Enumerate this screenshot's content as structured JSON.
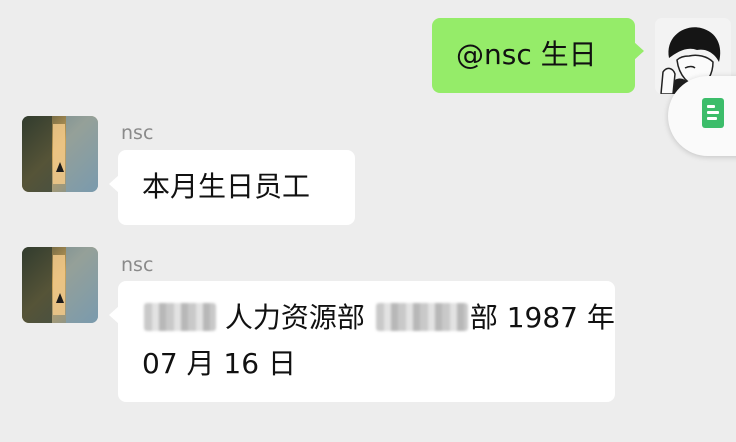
{
  "messages": [
    {
      "direction": "outgoing",
      "text": "@nsc  生日"
    },
    {
      "direction": "incoming",
      "sender": "nsc",
      "text": "本月生日员工"
    },
    {
      "direction": "incoming",
      "sender": "nsc",
      "text_part_1": "人力资源部",
      "text_part_2": "部 1987 年",
      "text_line_2": "07 月 16 日",
      "redacted": true
    }
  ],
  "icons": {
    "floating_button": "document-icon",
    "self_avatar": "user-avatar",
    "bot_avatar": "nsc-avatar"
  },
  "colors": {
    "background": "#ededed",
    "outgoing_bubble": "#95ec69",
    "incoming_bubble": "#ffffff",
    "sender_name": "#8a8a8a",
    "doc_icon": "#3cbd6a"
  }
}
